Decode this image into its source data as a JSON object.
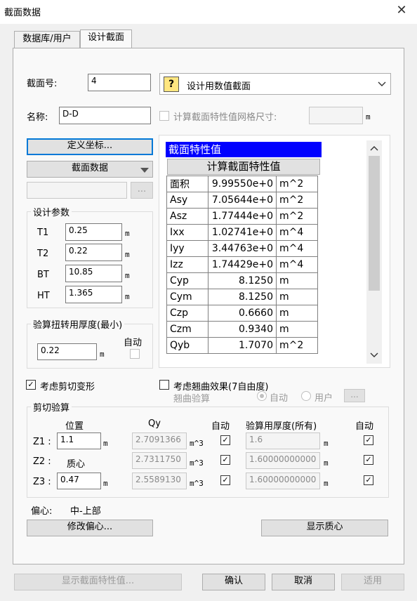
{
  "window": {
    "title": "截面数据",
    "close_glyph": "✕"
  },
  "tabs": [
    {
      "label": "数据库/用户"
    },
    {
      "label": "设计截面"
    }
  ],
  "section_no": {
    "label": "截面号:",
    "value": "4"
  },
  "section_type": {
    "value": "设计用数值截面"
  },
  "name": {
    "label": "名称:",
    "value": "D-D"
  },
  "mesh": {
    "label": "计算截面特性值网格尺寸:",
    "unit": "m",
    "value": ""
  },
  "buttons": {
    "define_coords": "定义坐标...",
    "section_data": "截面数据",
    "ellipsis": "...",
    "modify_offset": "修改偏心...",
    "show_centroid": "显示质心",
    "show_props": "显示截面特性值...",
    "ok": "确认",
    "cancel": "取消",
    "apply": "适用",
    "small_ellipsis": "..."
  },
  "design_params": {
    "title": "设计参数",
    "rows": [
      {
        "label": "T1",
        "value": "0.25",
        "unit": "m"
      },
      {
        "label": "T2",
        "value": "0.22",
        "unit": "m"
      },
      {
        "label": "BT",
        "value": "10.85",
        "unit": "m"
      },
      {
        "label": "HT",
        "value": "1.365",
        "unit": "m"
      }
    ]
  },
  "torsion": {
    "title": "验算扭转用厚度(最小)",
    "auto_label": "自动",
    "value": "0.22",
    "unit": "m"
  },
  "props_table": {
    "header": "截面特性值",
    "calc_button": "计算截面特性值",
    "rows": [
      {
        "name": "面积",
        "value": "9.99550e+0",
        "unit": "m^2"
      },
      {
        "name": "Asy",
        "value": "7.05644e+0",
        "unit": "m^2"
      },
      {
        "name": "Asz",
        "value": "1.77444e+0",
        "unit": "m^2"
      },
      {
        "name": "Ixx",
        "value": "1.02741e+0",
        "unit": "m^4"
      },
      {
        "name": "Iyy",
        "value": "3.44763e+0",
        "unit": "m^4"
      },
      {
        "name": "Izz",
        "value": "1.74429e+0",
        "unit": "m^4"
      },
      {
        "name": "Cyp",
        "value": "8.1250",
        "unit": "m"
      },
      {
        "name": "Cym",
        "value": "8.1250",
        "unit": "m"
      },
      {
        "name": "Czp",
        "value": "0.6660",
        "unit": "m"
      },
      {
        "name": "Czm",
        "value": "0.9340",
        "unit": "m"
      },
      {
        "name": "Qyb",
        "value": "1.7070",
        "unit": "m^2"
      }
    ]
  },
  "options": {
    "shear_deform": {
      "label": "考虑剪切变形",
      "checked": true,
      "mark": "✓"
    },
    "warping": {
      "label": "考虑翘曲效果(7自由度)",
      "checked": false
    },
    "warping_check": {
      "label": "翘曲验算",
      "auto": "自动",
      "user": "用户"
    }
  },
  "shear_check": {
    "title": "剪切验算",
    "col_position": "位置",
    "col_qy": "Qy",
    "col_auto": "自动",
    "col_thickness": "验算用厚度(所有)",
    "col_auto2": "自动",
    "rows": [
      {
        "label": "Z1 :",
        "position": "1.1",
        "pos_unit": "m",
        "qy": "2.7091366",
        "qy_unit": "m^3",
        "thickness": "1.6",
        "t_unit": "m"
      },
      {
        "label": "Z2 :",
        "position": "质心",
        "pos_unit": "",
        "qy": "2.7311750",
        "qy_unit": "m^3",
        "thickness": "1.60000000000",
        "t_unit": "m"
      },
      {
        "label": "Z3 :",
        "position": "0.47",
        "pos_unit": "m",
        "qy": "2.5589130",
        "qy_unit": "m^3",
        "thickness": "1.60000000000",
        "t_unit": "m"
      }
    ],
    "check_mark": "✓"
  },
  "offset": {
    "label": "偏心:",
    "value": "中-上部"
  },
  "icons": {
    "dropdown": "chevron-down-icon",
    "scroll_up": "chevron-up-icon",
    "scroll_down": "chevron-down-icon"
  },
  "colors": {
    "table_header_bg": "#0000ff",
    "table_header_fg": "#ffffff",
    "focus": "#0078d7"
  }
}
